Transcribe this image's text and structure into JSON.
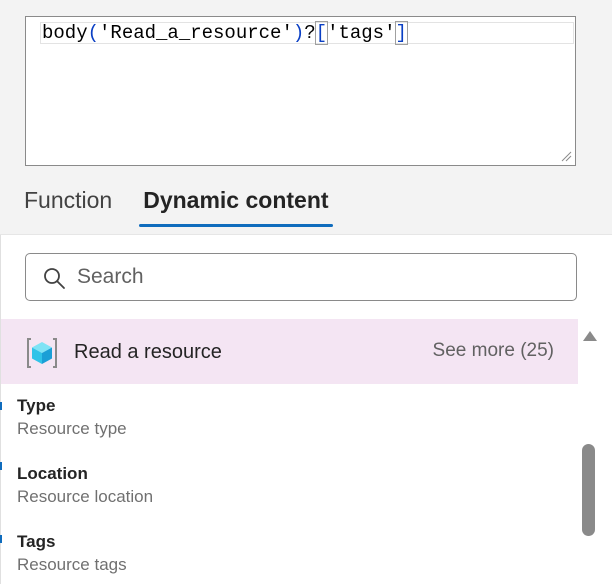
{
  "editor": {
    "code_parts": [
      "body",
      "(",
      "'Read_a_resource'",
      ")",
      "?",
      "[",
      "'tags'",
      "]"
    ]
  },
  "tabs": [
    {
      "label": "Function",
      "selected": false
    },
    {
      "label": "Dynamic content",
      "selected": true
    }
  ],
  "search": {
    "placeholder": "Search",
    "value": ""
  },
  "section": {
    "title": "Read a resource",
    "see_more": "See more (25)",
    "icon": "azure-resource-icon"
  },
  "items": [
    {
      "title": "Type",
      "description": "Resource type"
    },
    {
      "title": "Location",
      "description": "Resource location"
    },
    {
      "title": "Tags",
      "description": "Resource tags"
    }
  ],
  "colors": {
    "accent": "#0f6cbd",
    "section_bg": "#f4e5f3",
    "code_paren": "#0a3fc4"
  }
}
